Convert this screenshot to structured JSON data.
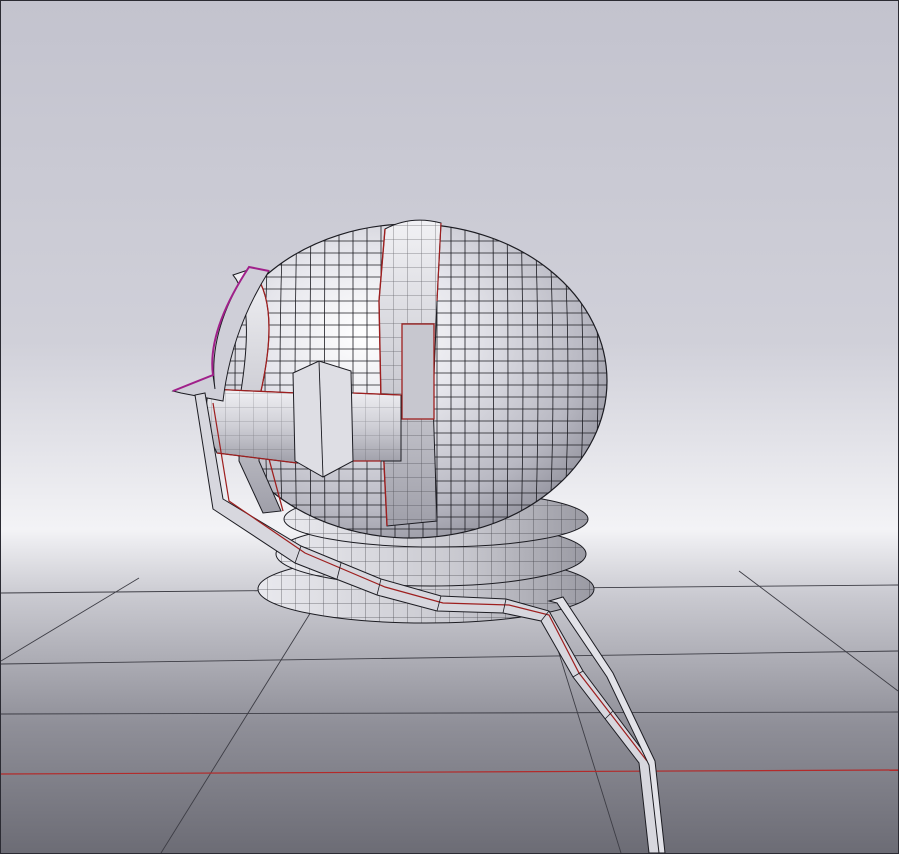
{
  "viewport": {
    "mode": "3d-perspective",
    "background_gradient": {
      "top": "#c2c2cd",
      "horizon": "#f4f4f7",
      "floor_near": "#707079"
    },
    "grid": {
      "visible": true,
      "line_color": "#3a3a42",
      "axis_x_color": "#b32a2a"
    },
    "model": {
      "name": "helmet",
      "shading": "smooth-with-wireframe",
      "surface_color": "#d9d9e0",
      "wire_color": "#1c1c22",
      "seam_color": "#9e1f1f",
      "selected_edge_color": "#a0208a"
    }
  }
}
